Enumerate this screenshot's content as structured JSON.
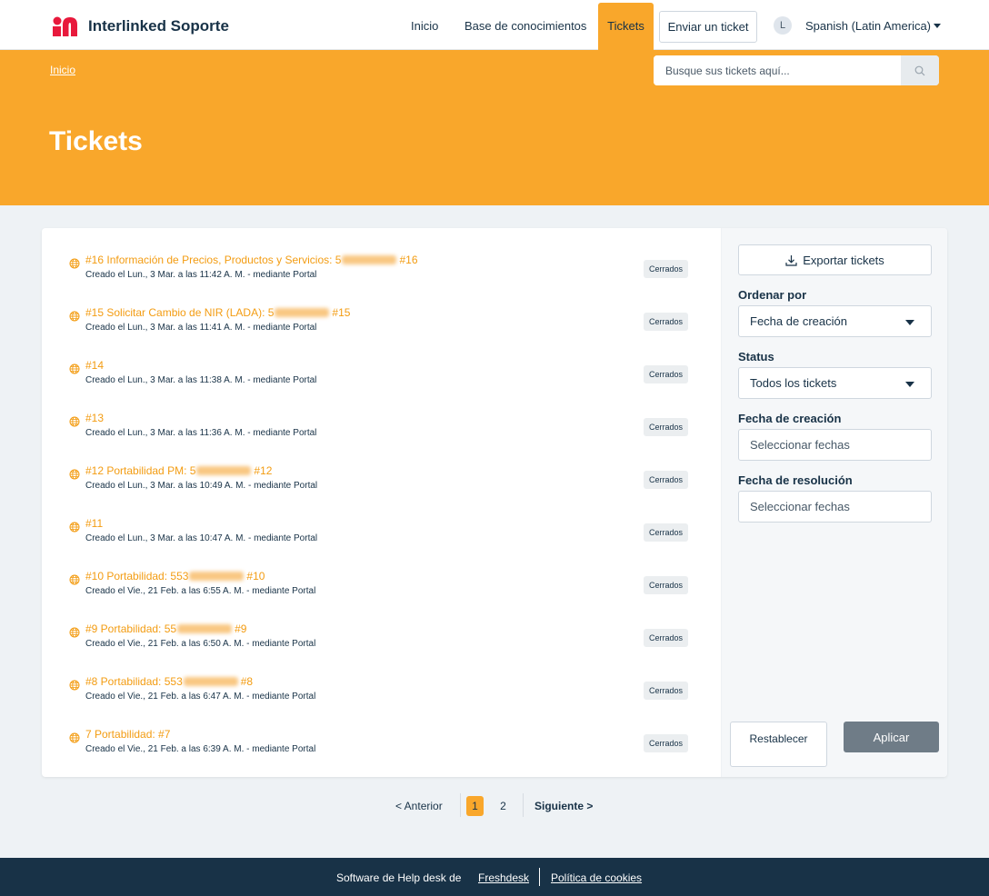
{
  "header": {
    "brand": "Interlinked Soporte",
    "nav": [
      "Inicio",
      "Base de conocimientos",
      "Tickets"
    ],
    "new_ticket": "Enviar un ticket",
    "avatar_initial": "L",
    "language": "Spanish (Latin America)"
  },
  "banner": {
    "breadcrumb": "Inicio",
    "search_placeholder": "Busque sus tickets aquí...",
    "title": "Tickets"
  },
  "tickets": [
    {
      "pre": "#16 Información de Precios, Productos y Servicios: 5",
      "post": "#16",
      "redacted": true,
      "meta": "Creado el Lun., 3 Mar. a las 11:42 A. M. - mediante Portal",
      "status": "Cerrados"
    },
    {
      "pre": "#15 Solicitar Cambio de NIR (LADA): 5",
      "post": "#15",
      "redacted": true,
      "meta": "Creado el Lun., 3 Mar. a las 11:41 A. M. - mediante Portal",
      "status": "Cerrados"
    },
    {
      "pre": "#14",
      "post": "",
      "redacted": false,
      "meta": "Creado el Lun., 3 Mar. a las 11:38 A. M. - mediante Portal",
      "status": "Cerrados"
    },
    {
      "pre": "#13",
      "post": "",
      "redacted": false,
      "meta": "Creado el Lun., 3 Mar. a las 11:36 A. M. - mediante Portal",
      "status": "Cerrados"
    },
    {
      "pre": "#12 Portabilidad PM: 5",
      "post": "#12",
      "redacted": true,
      "meta": "Creado el Lun., 3 Mar. a las 10:49 A. M. - mediante Portal",
      "status": "Cerrados"
    },
    {
      "pre": "#11",
      "post": "",
      "redacted": false,
      "meta": "Creado el Lun., 3 Mar. a las 10:47 A. M. - mediante Portal",
      "status": "Cerrados"
    },
    {
      "pre": "#10 Portabilidad: 553",
      "post": "#10",
      "redacted": true,
      "meta": "Creado el Vie., 21 Feb. a las 6:55 A. M. - mediante Portal",
      "status": "Cerrados"
    },
    {
      "pre": "#9 Portabilidad: 55",
      "post": "#9",
      "redacted": true,
      "meta": "Creado el Vie., 21 Feb. a las 6:50 A. M. - mediante Portal",
      "status": "Cerrados"
    },
    {
      "pre": "#8 Portabilidad: 553",
      "post": "#8",
      "redacted": true,
      "meta": "Creado el Vie., 21 Feb. a las 6:47 A. M. - mediante Portal",
      "status": "Cerrados"
    },
    {
      "pre": "7 Portabilidad: #7",
      "post": "",
      "redacted": false,
      "meta": "Creado el Vie., 21 Feb. a las 6:39 A. M. - mediante Portal",
      "status": "Cerrados"
    }
  ],
  "sidebar": {
    "export": "Exportar tickets",
    "sort_label": "Ordenar por",
    "sort_value": "Fecha de creación",
    "status_label": "Status",
    "status_value": "Todos los tickets",
    "created_label": "Fecha de creación",
    "created_placeholder": "Seleccionar fechas",
    "resolved_label": "Fecha de resolución",
    "resolved_placeholder": "Seleccionar fechas",
    "reset": "Restablecer",
    "apply": "Aplicar"
  },
  "pagination": {
    "prev": "< Anterior",
    "pages": [
      "1",
      "2"
    ],
    "current": "1",
    "next": "Siguiente >"
  },
  "footer": {
    "text": "Software de Help desk de",
    "link1": "Freshdesk",
    "link2": "Política de cookies"
  },
  "colors": {
    "accent": "#f9a72b",
    "link": "#f39c12",
    "footer": "#183247",
    "apply_button": "#6f7c87"
  },
  "icons": [
    "brand-logo-icon",
    "search-icon",
    "globe-icon",
    "download-icon",
    "dropdown-caret-icon"
  ]
}
